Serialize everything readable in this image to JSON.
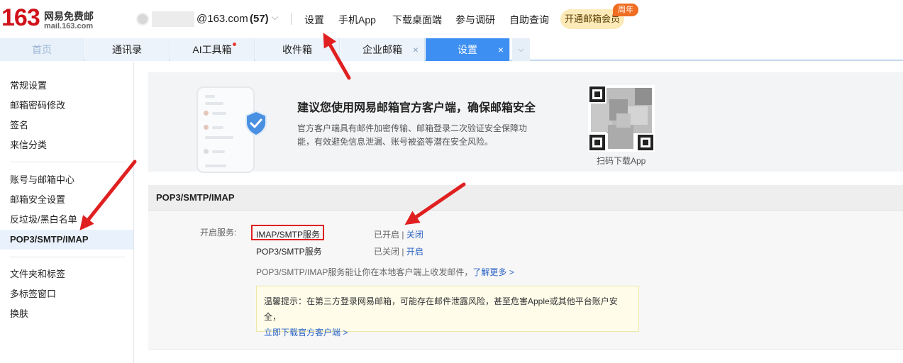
{
  "header": {
    "logo_number": "163",
    "logo_name": "网易免费邮",
    "logo_domain": "mail.163.com",
    "account_domain": "@163.com",
    "unread_count": "(57)",
    "nav_links": [
      "设置",
      "手机App",
      "下载桌面端",
      "参与调研",
      "自助查询"
    ],
    "vip_button": "开通邮箱会员",
    "vip_badge": "周年"
  },
  "tabs": [
    {
      "label": "首页"
    },
    {
      "label": "通讯录"
    },
    {
      "label": "AI工具箱"
    },
    {
      "label": "收件箱"
    },
    {
      "label": "企业邮箱",
      "close": "×"
    },
    {
      "label": "设置",
      "close": "×"
    }
  ],
  "sidebar": {
    "groups": [
      [
        "常规设置",
        "邮箱密码修改",
        "签名",
        "来信分类"
      ],
      [
        "账号与邮箱中心",
        "邮箱安全设置",
        "反垃圾/黑白名单",
        "POP3/SMTP/IMAP"
      ],
      [
        "文件夹和标签",
        "多标签窗口",
        "换肤"
      ]
    ],
    "active": "POP3/SMTP/IMAP"
  },
  "banner": {
    "title": "建议您使用网易邮箱官方客户端，确保邮箱安全",
    "desc": "官方客户端具有邮件加密传输、邮箱登录二次验证安全保障功能，有效避免信息泄漏、账号被盗等潜在安全风险。",
    "qr_caption": "扫码下载App"
  },
  "section": {
    "title": "POP3/SMTP/IMAP",
    "services_label": "开启服务:",
    "services": [
      {
        "name": "IMAP/SMTP服务",
        "status": "已开启",
        "sep": " | ",
        "action": "关闭"
      },
      {
        "name": "POP3/SMTP服务",
        "status": "已关闭",
        "sep": " | ",
        "action": "开启"
      }
    ],
    "desc": "POP3/SMTP/IMAP服务能让你在本地客户端上收发邮件，",
    "desc_link": "了解更多 >",
    "tip_text": "温馨提示：在第三方登录网易邮箱，可能存在邮件泄露风险，甚至危害Apple或其他平台账户安全，",
    "tip_link": "立即下载官方客户端 >"
  },
  "colors": {
    "brand_red": "#d0121b",
    "active_tab": "#3d8ff2",
    "link": "#2a62c3",
    "annotation_arrow": "#e02020"
  }
}
